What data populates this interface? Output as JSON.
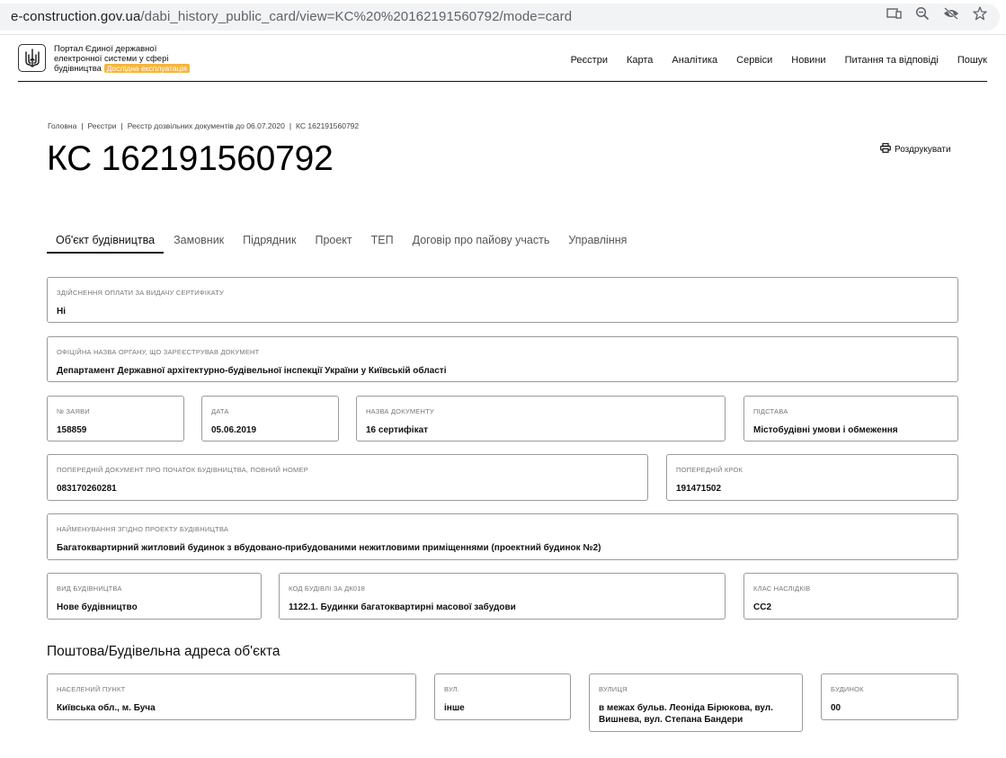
{
  "browser": {
    "url_host": "e-construction.gov.ua",
    "url_path": "/dabi_history_public_card/view=KC%20%20162191560792/mode=card",
    "icons": [
      "install-app-icon",
      "zoom-icon",
      "eye-off-icon",
      "bookmark-star-icon"
    ]
  },
  "header": {
    "portal_line1": "Портал Єдиної державної",
    "portal_line2": "електронної системи у сфері",
    "portal_line3": "будівництва",
    "badge": "Дослідна експлуатація",
    "nav": [
      "Реєстри",
      "Карта",
      "Аналітика",
      "Сервіси",
      "Новини",
      "Питання та відповіді",
      "Пошук"
    ]
  },
  "breadcrumb": [
    "Головна",
    "Реєстри",
    "Реєстр дозвільних документів до 06.07.2020",
    "КС 162191560792"
  ],
  "title": "КС 162191560792",
  "print_label": "Роздрукувати",
  "tabs": [
    "Об'єкт будівництва",
    "Замовник",
    "Підрядник",
    "Проект",
    "ТЕП",
    "Договір про пайову участь",
    "Управління"
  ],
  "fields": {
    "payment": {
      "label": "Здійснення оплати за видачу сертифікату",
      "value": "Ні"
    },
    "organ": {
      "label": "Офіційна назва органу, що зареєстрував документ",
      "value": "Департамент Державної архітектурно-будівельної інспекції України у Київській області"
    },
    "app_no": {
      "label": "№ заяви",
      "value": "158859"
    },
    "date": {
      "label": "Дата",
      "value": "05.06.2019"
    },
    "doc_name": {
      "label": "Назва документу",
      "value": "16 сертифікат"
    },
    "basis": {
      "label": "Підстава",
      "value": "Містобудівні умови і обмеження"
    },
    "prev_doc": {
      "label": "Попередній документ про початок будівництва, повний номер",
      "value": "083170260281"
    },
    "prev_step": {
      "label": "Попередній крок",
      "value": "191471502"
    },
    "project_name": {
      "label": "Найменування згідно проекту будівництва",
      "value": "Багатоквартирний житловий будинок з вбудовано-прибудованими нежитловими приміщеннями (проектний будинок №2)"
    },
    "constr_type": {
      "label": "Вид будівництва",
      "value": "Нове будівництво"
    },
    "building_code": {
      "label": "Код будівлі за ДК018",
      "value": "1122.1. Будинки багатоквартирні масової забудови"
    },
    "consequence": {
      "label": "Клас наслідків",
      "value": "СС2"
    }
  },
  "address_section": {
    "title": "Поштова/Будівельна адреса об'єкта",
    "settlement": {
      "label": "Населений пункт",
      "value": "Київська обл., м. Буча"
    },
    "street_type": {
      "label": "Вул.",
      "value": "інше"
    },
    "street": {
      "label": "Вулиця",
      "value": "в межах бульв. Леоніда Бірюкова, вул. Вишнева, вул. Степана Бандери"
    },
    "building": {
      "label": "Будинок",
      "value": "00"
    }
  }
}
